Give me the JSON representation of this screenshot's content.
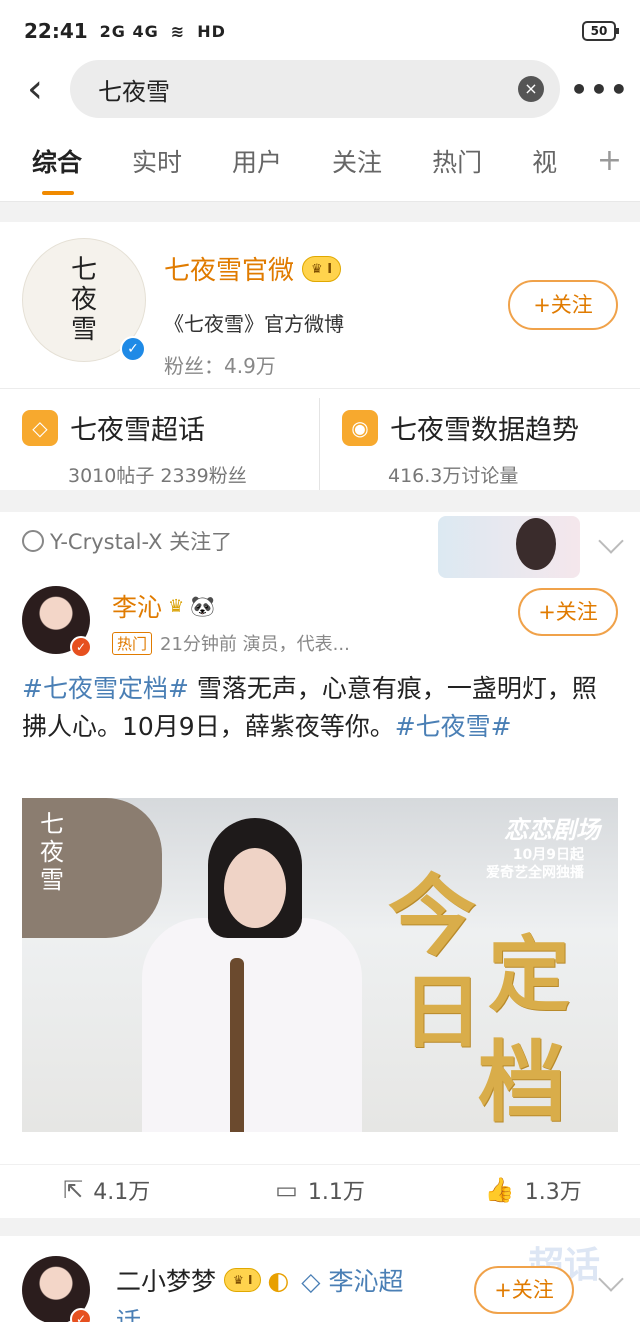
{
  "status": {
    "time": "22:41",
    "signal": "2G 4G",
    "hd": "HD",
    "battery": "50"
  },
  "search": {
    "query": "七夜雪",
    "clear_icon": "×"
  },
  "tabs": [
    "综合",
    "实时",
    "用户",
    "关注",
    "热门",
    "视"
  ],
  "account": {
    "avatar_text_1": "七",
    "avatar_text_2": "夜",
    "avatar_text_3": "雪",
    "name": "七夜雪官微",
    "level": "I",
    "description": "《七夜雪》官方微博",
    "fans": "粉丝：4.9万",
    "follow_label": "+关注"
  },
  "topics": [
    {
      "name": "七夜雪超话",
      "stats": "3010帖子  2339粉丝"
    },
    {
      "name": "七夜雪数据趋势",
      "stats": "416.3万讨论量"
    }
  ],
  "post": {
    "liked_by": "Y-Crystal-X 关注了",
    "author": "李沁",
    "author_emoji": "🐼",
    "hot_tag": "热门",
    "meta": "21分钟前  演员，代表...",
    "follow_label": "+关注",
    "text_tag1": "#七夜雪定档#",
    "text_body": " 雪落无声，心意有痕，一盏明灯，照拂人心。10月9日，薛紫夜等你。",
    "text_tag2": "#七夜雪#",
    "image": {
      "brush_1": "七",
      "brush_2": "夜",
      "brush_3": "雪",
      "platform_logo": "恋恋剧场",
      "date_line_1": "10月9日起",
      "date_line_2": "爱奇艺全网独播",
      "gold_1": "今",
      "gold_2": "定",
      "gold_3": "日",
      "gold_4": "档"
    },
    "share_count": "4.1万",
    "comment_count": "1.1万",
    "like_count": "1.3万"
  },
  "next_post": {
    "author": "二小梦梦",
    "level": "I",
    "topic": "李沁超",
    "topic_wrap": "话",
    "follow_label": "+关注",
    "watermark": "超话"
  }
}
